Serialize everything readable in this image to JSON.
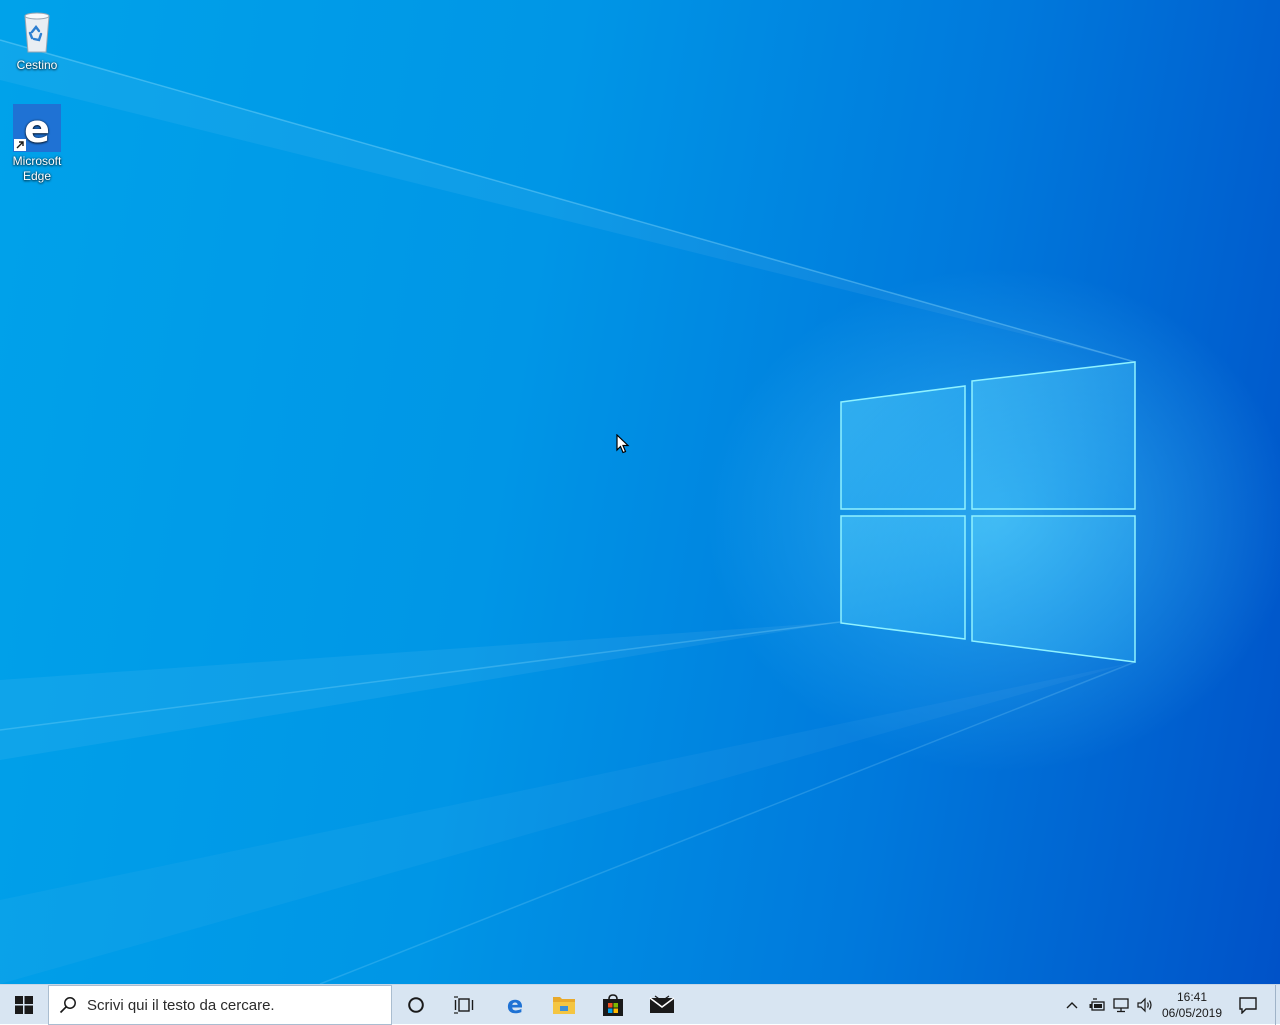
{
  "desktop": {
    "icons": [
      {
        "label": "Cestino",
        "icon": "recycle-bin-icon"
      },
      {
        "label": "Microsoft Edge",
        "icon": "edge-icon"
      }
    ]
  },
  "taskbar": {
    "start_icon": "windows-logo-icon",
    "search": {
      "placeholder": "Scrivi qui il testo da cercare.",
      "value": ""
    },
    "pinned": [
      {
        "name": "Cortana",
        "icon": "cortana-circle-icon"
      },
      {
        "name": "Visualizzazione attività",
        "icon": "task-view-icon"
      },
      {
        "name": "Microsoft Edge",
        "icon": "edge-icon"
      },
      {
        "name": "Esplora file",
        "icon": "folder-icon"
      },
      {
        "name": "Microsoft Store",
        "icon": "store-bag-icon"
      },
      {
        "name": "Posta",
        "icon": "mail-icon"
      }
    ],
    "tray": {
      "icons": [
        "chevron-up-icon",
        "battery-icon",
        "network-icon",
        "volume-icon"
      ],
      "time": "16:41",
      "date": "06/05/2019",
      "notification_icon": "action-center-icon"
    }
  },
  "colors": {
    "taskbar_bg": "#d8e5f2",
    "desktop_blue": "#0096e6",
    "edge_blue": "#1f72d4",
    "explorer_yellow": "#f4c542"
  }
}
